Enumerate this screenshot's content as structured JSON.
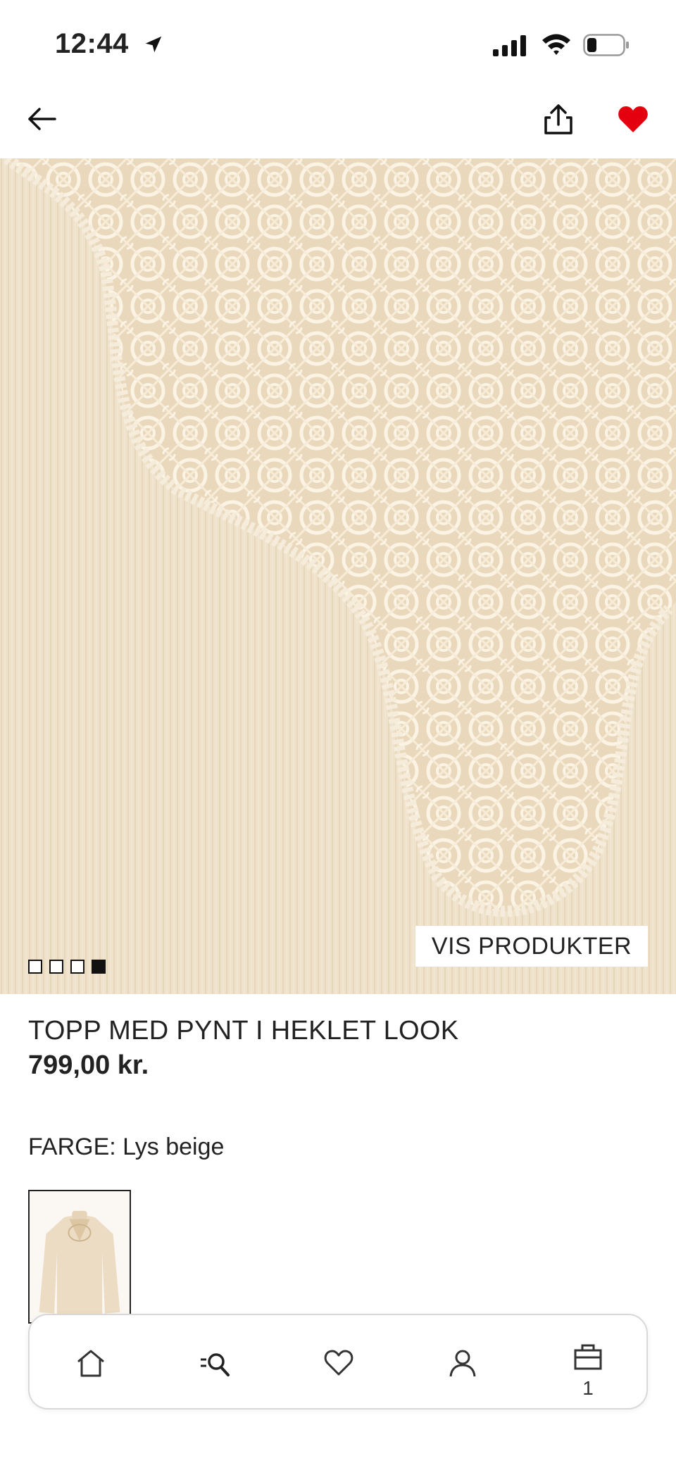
{
  "status_bar": {
    "time": "12:44"
  },
  "product": {
    "title": "TOPP MED PYNT I HEKLET LOOK",
    "price": "799,00 kr.",
    "color_label": "FARGE: Lys beige",
    "gallery_count": 4,
    "gallery_active_index": 4,
    "vis_produkter_label": "VIS PRODUKTER"
  },
  "icons": {
    "back": "arrow-left-icon",
    "share": "share-icon",
    "favorite": "heart-filled-icon",
    "home": "home-icon",
    "search": "search-icon",
    "wishlist": "heart-icon",
    "account": "user-icon",
    "bag": "bag-icon"
  },
  "bottom_nav": {
    "bag_count": "1"
  },
  "colors": {
    "favorite_red": "#e50010",
    "fabric_beige": "#efe2cb"
  }
}
